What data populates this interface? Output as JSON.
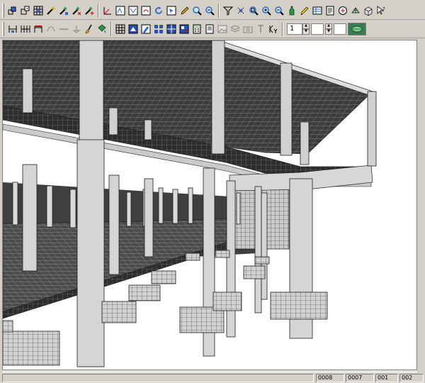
{
  "toolbar1": {
    "buttons": [
      {
        "name": "frame-icon"
      },
      {
        "name": "frame-copy-icon"
      },
      {
        "name": "grid-icon"
      },
      {
        "name": "wand-icon"
      },
      {
        "name": "wand-settings-icon"
      },
      {
        "name": "wand-delete-icon"
      },
      {
        "name": "wand-plus-icon"
      },
      {
        "name": "axis-icon"
      },
      {
        "name": "axis-xz-icon"
      },
      {
        "name": "axis-yz-icon"
      },
      {
        "name": "rotate-view-icon"
      },
      {
        "name": "refresh-icon"
      },
      {
        "name": "pick-icon"
      },
      {
        "name": "pencil-icon"
      },
      {
        "name": "zoom-in-icon"
      },
      {
        "name": "zoom-out-icon"
      },
      {
        "name": "filter-icon"
      },
      {
        "name": "node-select-icon"
      },
      {
        "name": "zoom-window-icon"
      },
      {
        "name": "zoom-all-icon"
      },
      {
        "name": "zoom-extents-icon"
      },
      {
        "name": "bottle-icon"
      },
      {
        "name": "highlighter-icon"
      },
      {
        "name": "table-icon"
      },
      {
        "name": "notes-icon"
      },
      {
        "name": "load-icon"
      },
      {
        "name": "mesh-icon"
      },
      {
        "name": "box-icon"
      },
      {
        "name": "help-cursor-icon"
      }
    ]
  },
  "toolbar2": {
    "level_value": "1",
    "buttons": [
      {
        "name": "wall-icon"
      },
      {
        "name": "walls-multi-icon"
      },
      {
        "name": "slab-icon"
      },
      {
        "name": "curve-icon"
      },
      {
        "name": "spring-icon"
      },
      {
        "name": "support-icon"
      },
      {
        "name": "brush-icon"
      },
      {
        "name": "paint-icon"
      },
      {
        "name": "grid-view-icon"
      },
      {
        "name": "render-icon"
      },
      {
        "name": "edit-mesh-icon"
      },
      {
        "name": "tiles-icon"
      },
      {
        "name": "tiles-selected-icon"
      },
      {
        "name": "panel-icon"
      },
      {
        "name": "calculator-icon"
      },
      {
        "name": "report-icon"
      },
      {
        "name": "image-icon"
      },
      {
        "name": "layers-icon"
      },
      {
        "name": "camera-icon"
      },
      {
        "name": "text-icon"
      },
      {
        "name": "coefficient-icon"
      }
    ]
  },
  "status": {
    "pane1": "0008",
    "pane2": "0007",
    "pane3": "001",
    "pane4": "002"
  }
}
